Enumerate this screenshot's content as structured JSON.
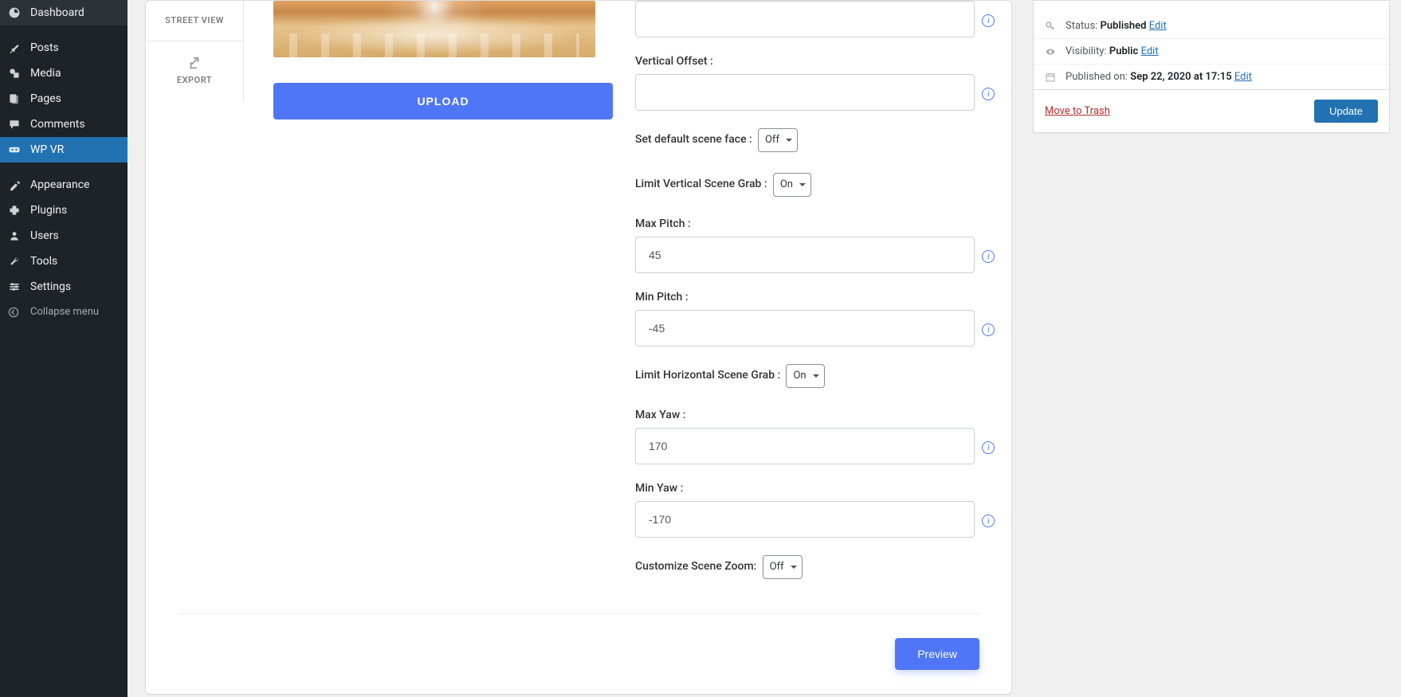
{
  "sidebar": {
    "items": [
      {
        "label": "Dashboard",
        "id": "dashboard"
      },
      {
        "label": "Posts",
        "id": "posts"
      },
      {
        "label": "Media",
        "id": "media"
      },
      {
        "label": "Pages",
        "id": "pages"
      },
      {
        "label": "Comments",
        "id": "comments"
      },
      {
        "label": "WP VR",
        "id": "wpvr"
      },
      {
        "label": "Appearance",
        "id": "appearance"
      },
      {
        "label": "Plugins",
        "id": "plugins"
      },
      {
        "label": "Users",
        "id": "users"
      },
      {
        "label": "Tools",
        "id": "tools"
      },
      {
        "label": "Settings",
        "id": "settings"
      }
    ],
    "collapse_label": "Collapse menu"
  },
  "inner_nav": {
    "street_view": "STREET VIEW",
    "export": "EXPORT"
  },
  "upload_label": "UPLOAD",
  "form": {
    "first_input": {
      "value": ""
    },
    "vertical_offset": {
      "label": "Vertical Offset :",
      "value": ""
    },
    "default_face": {
      "label": "Set default scene face :",
      "value": "Off"
    },
    "limit_vertical": {
      "label": "Limit Vertical Scene Grab :",
      "value": "On"
    },
    "max_pitch": {
      "label": "Max Pitch :",
      "value": "45"
    },
    "min_pitch": {
      "label": "Min Pitch :",
      "value": "-45"
    },
    "limit_horizontal": {
      "label": "Limit Horizontal Scene Grab :",
      "value": "On"
    },
    "max_yaw": {
      "label": "Max Yaw :",
      "value": "170"
    },
    "min_yaw": {
      "label": "Min Yaw :",
      "value": "-170"
    },
    "custom_zoom": {
      "label": "Customize Scene Zoom:",
      "value": "Off"
    }
  },
  "preview_label": "Preview",
  "publish": {
    "status_label": "Status: ",
    "status_value": "Published",
    "visibility_label": "Visibility: ",
    "visibility_value": "Public",
    "published_label": "Published on: ",
    "published_value": "Sep 22, 2020 at 17:15",
    "edit_label": "Edit",
    "trash_label": "Move to Trash",
    "update_label": "Update"
  }
}
